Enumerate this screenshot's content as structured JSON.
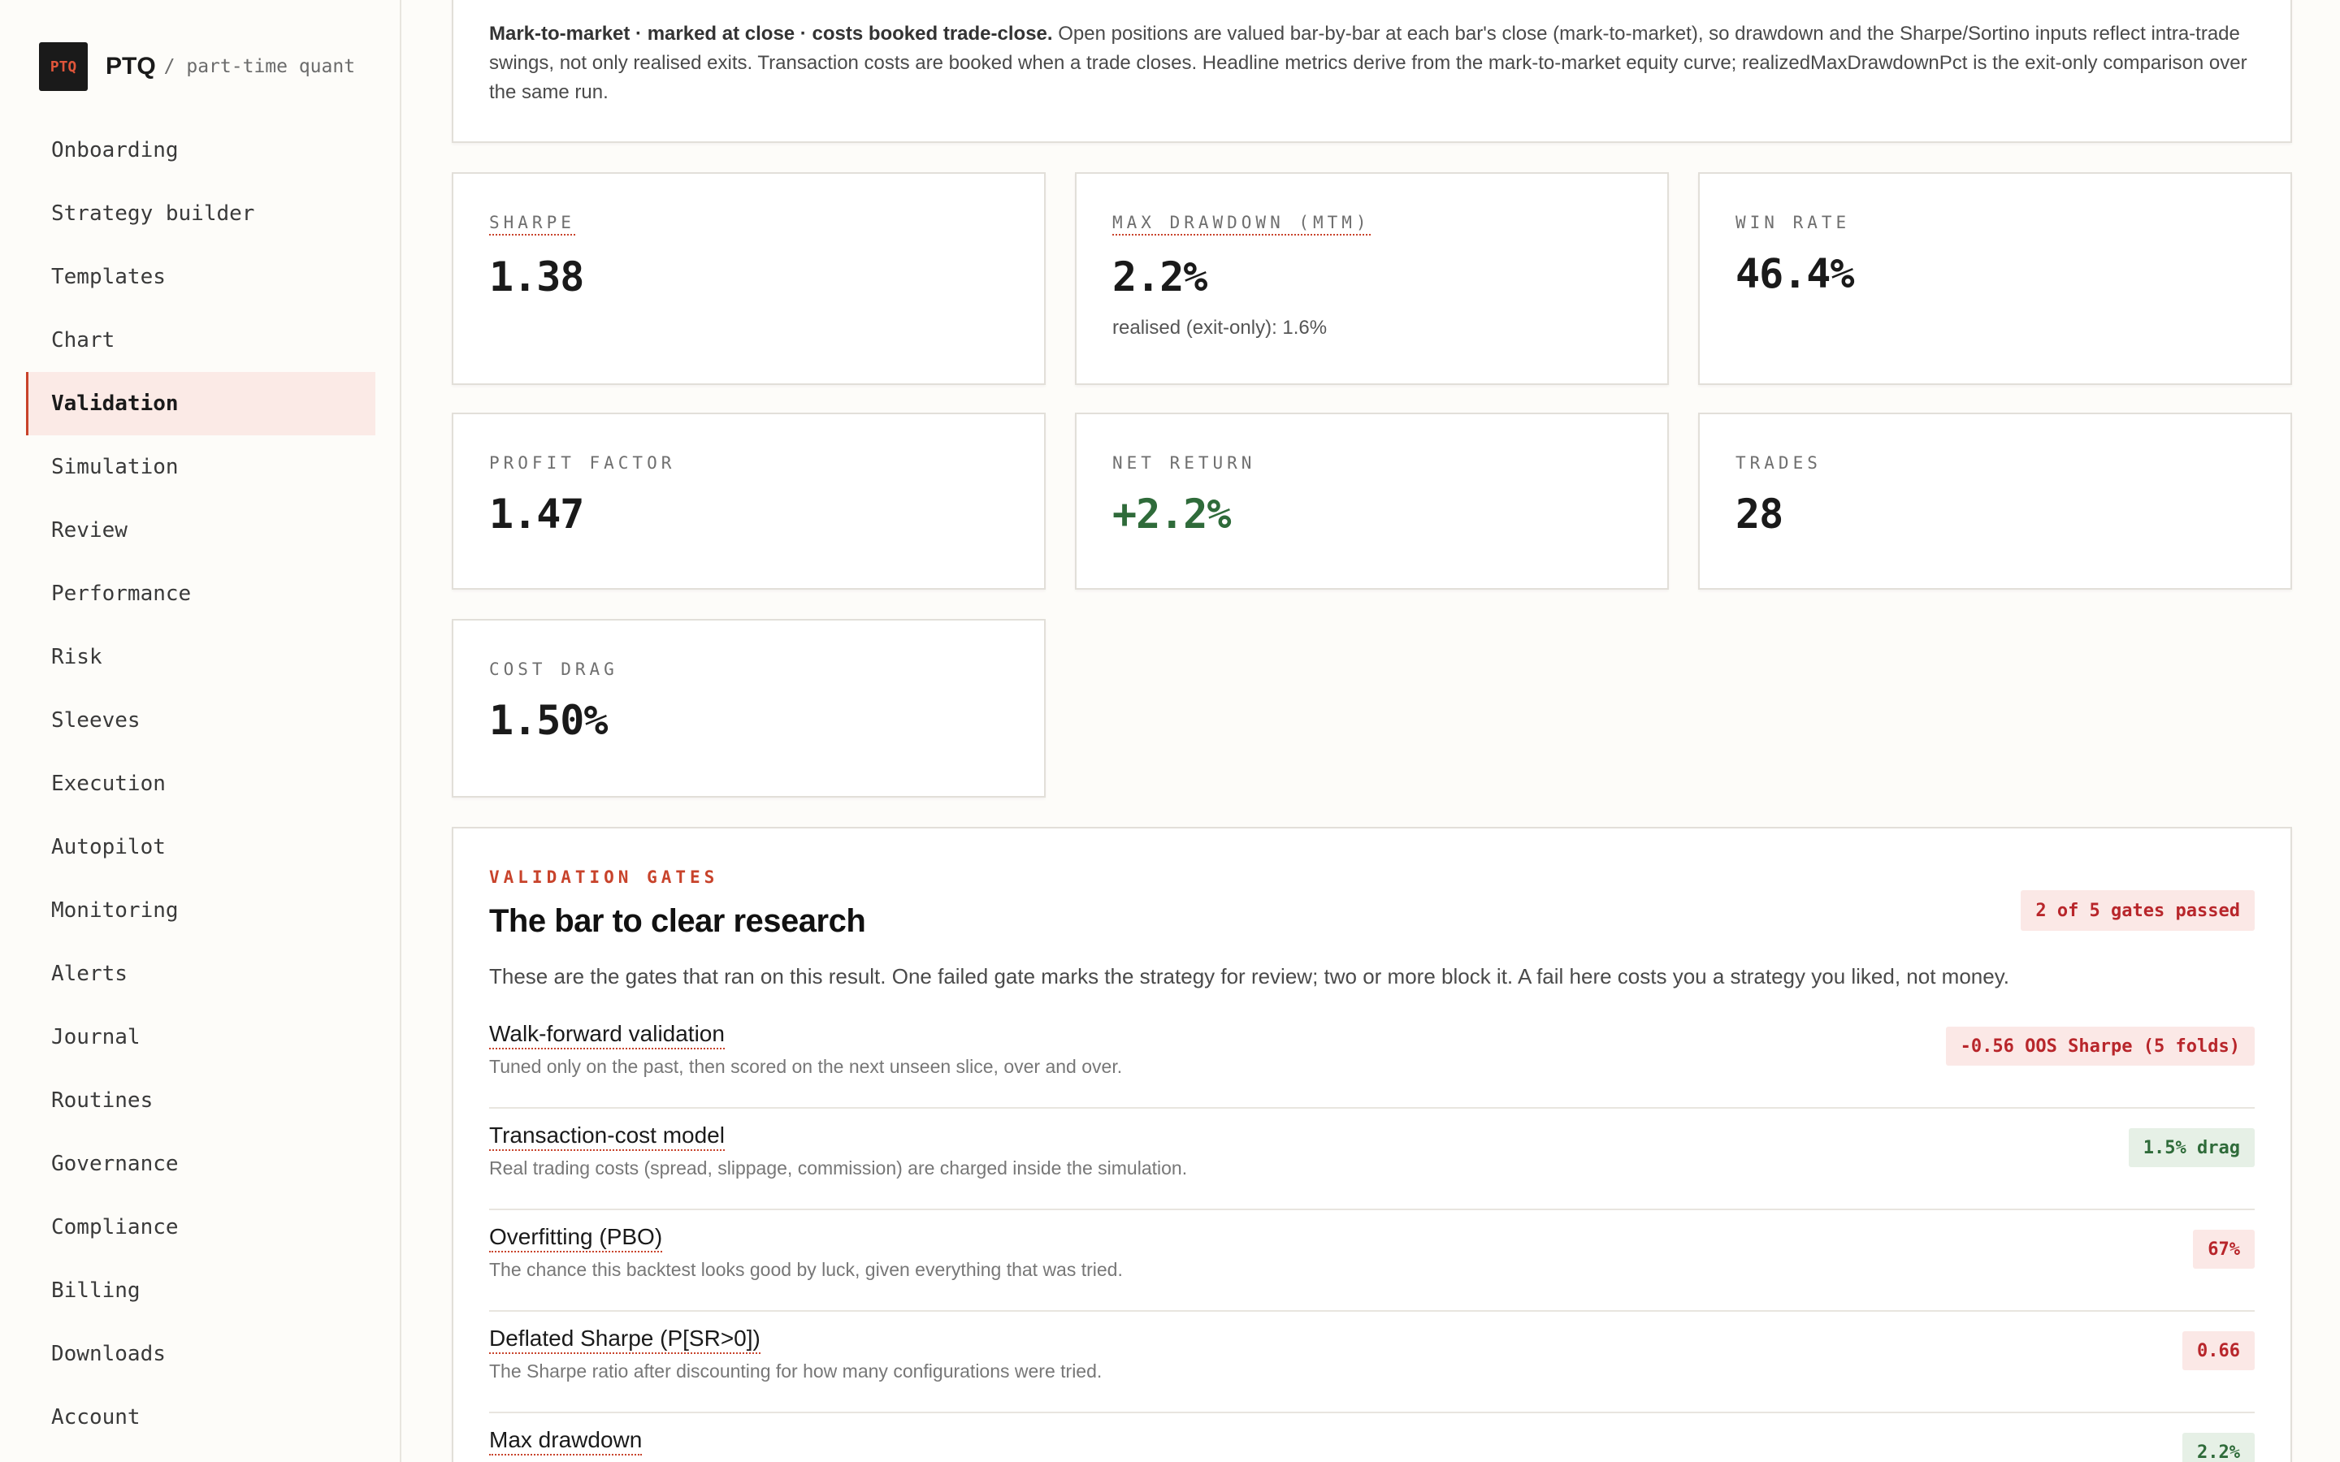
{
  "brand": {
    "logo": "PTQ",
    "name": "PTQ",
    "tagline": "/ part-time quant"
  },
  "nav": {
    "items": [
      "Onboarding",
      "Strategy builder",
      "Templates",
      "Chart",
      "Validation",
      "Simulation",
      "Review",
      "Performance",
      "Risk",
      "Sleeves",
      "Execution",
      "Autopilot",
      "Monitoring",
      "Alerts",
      "Journal",
      "Routines",
      "Governance",
      "Compliance",
      "Billing",
      "Downloads",
      "Account"
    ],
    "active": "Validation"
  },
  "note": {
    "lead": "Mark-to-market · marked at close · costs booked trade-close.",
    "body": " Open positions are valued bar-by-bar at each bar's close (mark-to-market), so drawdown and the Sharpe/Sortino inputs reflect intra-trade swings, not only realised exits. Transaction costs are booked when a trade closes. Headline metrics derive from the mark-to-market equity curve; realizedMaxDrawdownPct is the exit-only comparison over the same run."
  },
  "metrics": {
    "sharpe": {
      "label": "SHARPE",
      "value": "1.38"
    },
    "max_drawdown": {
      "label": "MAX DRAWDOWN (MTM)",
      "value": "2.2%",
      "sub": "realised (exit-only): 1.6%"
    },
    "win_rate": {
      "label": "WIN RATE",
      "value": "46.4%"
    },
    "profit_factor": {
      "label": "PROFIT FACTOR",
      "value": "1.47"
    },
    "net_return": {
      "label": "NET RETURN",
      "value": "+2.2%"
    },
    "trades": {
      "label": "TRADES",
      "value": "28"
    },
    "cost_drag": {
      "label": "COST DRAG",
      "value": "1.50%"
    }
  },
  "gates": {
    "eyebrow": "VALIDATION GATES",
    "title": "The bar to clear research",
    "badge": "2 of 5 gates passed",
    "intro": "These are the gates that ran on this result. One failed gate marks the strategy for review; two or more block it. A fail here costs you a strategy you liked, not money.",
    "items": [
      {
        "name": "Walk-forward validation",
        "desc": "Tuned only on the past, then scored on the next unseen slice, over and over.",
        "result": "-0.56 OOS Sharpe (5 folds)",
        "status": "fail"
      },
      {
        "name": "Transaction-cost model",
        "desc": "Real trading costs (spread, slippage, commission) are charged inside the simulation.",
        "result": "1.5% drag",
        "status": "pass"
      },
      {
        "name": "Overfitting (PBO)",
        "desc": "The chance this backtest looks good by luck, given everything that was tried.",
        "result": "67%",
        "status": "fail"
      },
      {
        "name": "Deflated Sharpe (P[SR>0])",
        "desc": "The Sharpe ratio after discounting for how many configurations were tried.",
        "result": "0.66",
        "status": "fail"
      },
      {
        "name": "Max drawdown",
        "desc": "",
        "result": "2.2%",
        "status": "pass"
      }
    ]
  }
}
